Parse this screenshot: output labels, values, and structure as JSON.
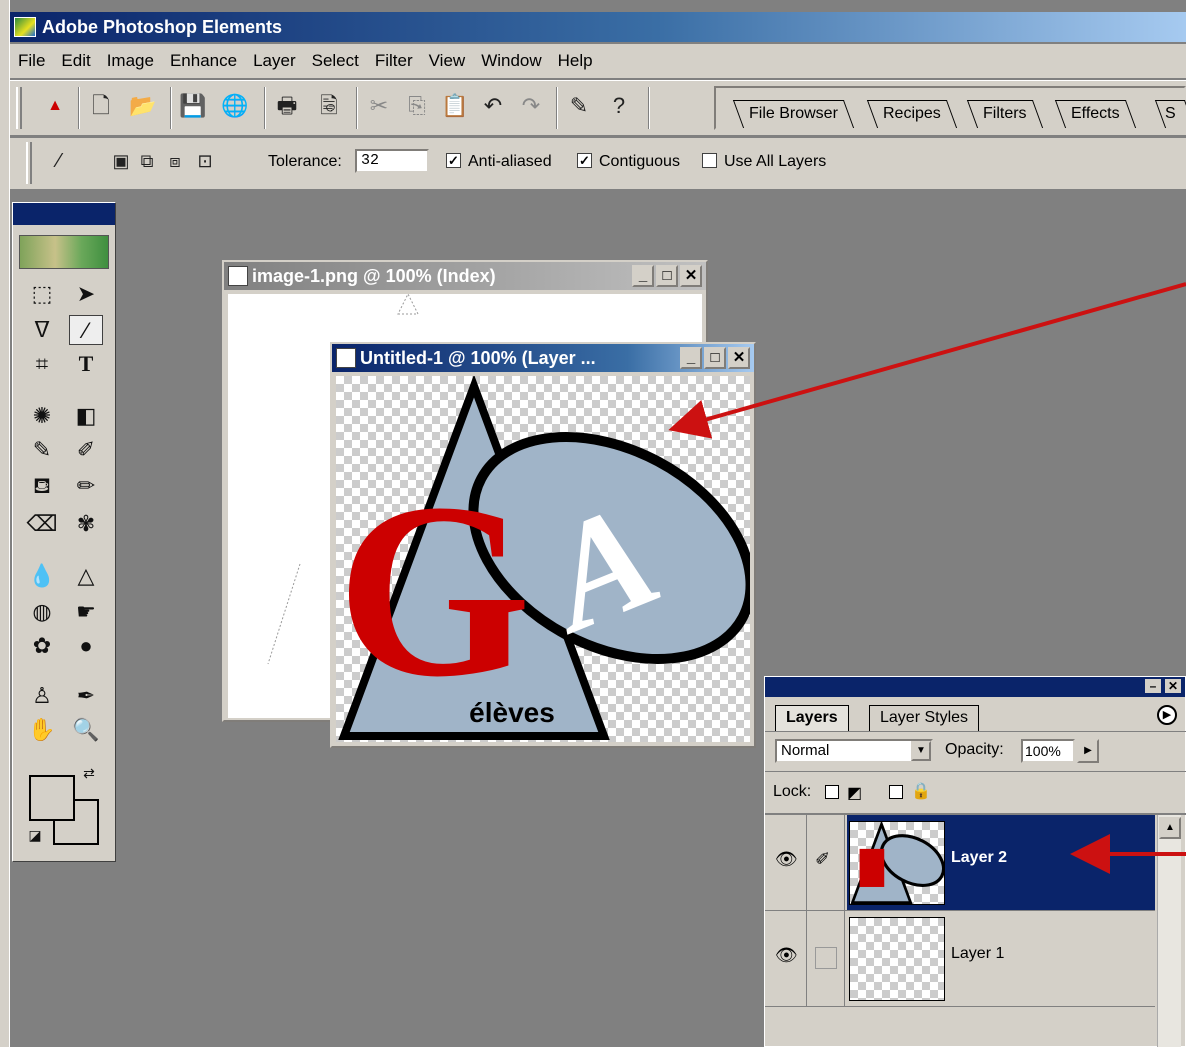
{
  "app": {
    "title": "Adobe Photoshop Elements"
  },
  "menu": [
    "File",
    "Edit",
    "Image",
    "Enhance",
    "Layer",
    "Select",
    "Filter",
    "View",
    "Window",
    "Help"
  ],
  "toolbar": {
    "icons": [
      "adobe-logo",
      "new-file",
      "open-file",
      "save",
      "save-for-web",
      "print",
      "print-preview",
      "cut",
      "copy",
      "paste",
      "undo",
      "redo",
      "step-back",
      "help"
    ]
  },
  "palette_well": {
    "tabs": [
      "File Browser",
      "Recipes",
      "Filters",
      "Effects",
      "S"
    ]
  },
  "options": {
    "tolerance_label": "Tolerance:",
    "tolerance_value": "32",
    "anti_aliased_label": "Anti-aliased",
    "anti_aliased_checked": true,
    "contiguous_label": "Contiguous",
    "contiguous_checked": true,
    "use_all_layers_label": "Use All Layers",
    "use_all_layers_checked": false
  },
  "windows": {
    "image1": {
      "title": "image-1.png @ 100% (Index)"
    },
    "untitled1": {
      "title": "Untitled-1 @ 100% (Layer ..."
    }
  },
  "artwork": {
    "letter_g": "G",
    "letter_a": "A",
    "caption": "élèves"
  },
  "layers_panel": {
    "tabs": [
      "Layers",
      "Layer Styles"
    ],
    "blend_mode": "Normal",
    "opacity_label": "Opacity:",
    "opacity_value": "100%",
    "lock_label": "Lock:",
    "layers": [
      {
        "name": "Layer 2",
        "selected": true
      },
      {
        "name": "Layer 1",
        "selected": false
      }
    ]
  },
  "colors": {
    "title_blue": "#0a246a",
    "arrow_red": "#cc1111",
    "logo_red": "#cc0000",
    "logo_blue": "#a0b4c8"
  }
}
